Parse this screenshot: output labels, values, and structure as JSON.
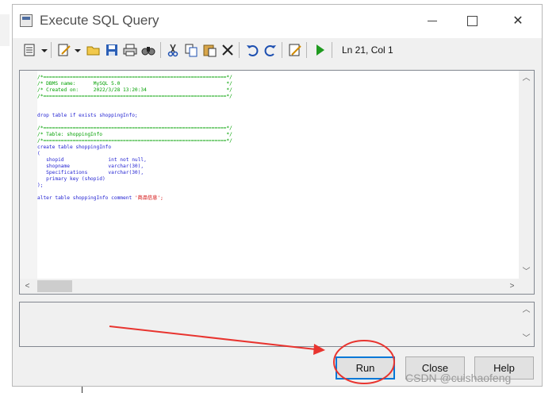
{
  "window": {
    "title": "Execute SQL Query",
    "controls": {
      "minimize": "minimize",
      "maximize": "maximize",
      "close": "✕"
    }
  },
  "toolbar": {
    "icons": [
      "script-icon",
      "edit-icon",
      "open-folder-icon",
      "save-icon",
      "print-icon",
      "find-icon",
      "cut-icon",
      "copy-icon",
      "paste-icon",
      "delete-icon",
      "undo-icon",
      "redo-icon",
      "properties-icon",
      "run-icon"
    ],
    "cursor_position": "Ln 21, Col 1"
  },
  "editor": {
    "lines": [
      {
        "cls": "cm",
        "text": "/*==============================================================*/"
      },
      {
        "cls": "cm",
        "text": "/* DBMS name:      MySQL 5.0                                    */"
      },
      {
        "cls": "cm",
        "text": "/* Created on:     2022/3/28 13:20:34                           */"
      },
      {
        "cls": "cm",
        "text": "/*==============================================================*/"
      },
      {
        "cls": "",
        "text": ""
      },
      {
        "cls": "",
        "text": ""
      },
      {
        "cls": "kw",
        "text": "drop table if exists shoppingInfo;"
      },
      {
        "cls": "",
        "text": ""
      },
      {
        "cls": "cm",
        "text": "/*==============================================================*/"
      },
      {
        "cls": "cm",
        "text": "/* Table: shoppingInfo                                          */"
      },
      {
        "cls": "cm",
        "text": "/*==============================================================*/"
      },
      {
        "cls": "kw",
        "text": "create table shoppingInfo"
      },
      {
        "cls": "kw",
        "text": "("
      },
      {
        "cls": "kw",
        "text": "   shopid               int not null,"
      },
      {
        "cls": "kw",
        "text": "   shopname             varchar(30),"
      },
      {
        "cls": "kw",
        "text": "   Specifications       varchar(30),"
      },
      {
        "cls": "kw",
        "text": "   primary key (shopid)"
      },
      {
        "cls": "kw",
        "text": ");"
      },
      {
        "cls": "",
        "text": ""
      },
      {
        "cls": "kw",
        "text": "alter table shoppingInfo comment "
      },
      {
        "cls": "str",
        "text": "'商品信息';"
      }
    ]
  },
  "buttons": {
    "run": "Run",
    "close": "Close",
    "help": "Help"
  },
  "watermark": "CSDN @cuishaofeng",
  "colors": {
    "comment": "#00a000",
    "keyword": "#2323d2",
    "string": "#d20000",
    "annotation": "#e8342f",
    "focus": "#0078d7"
  }
}
